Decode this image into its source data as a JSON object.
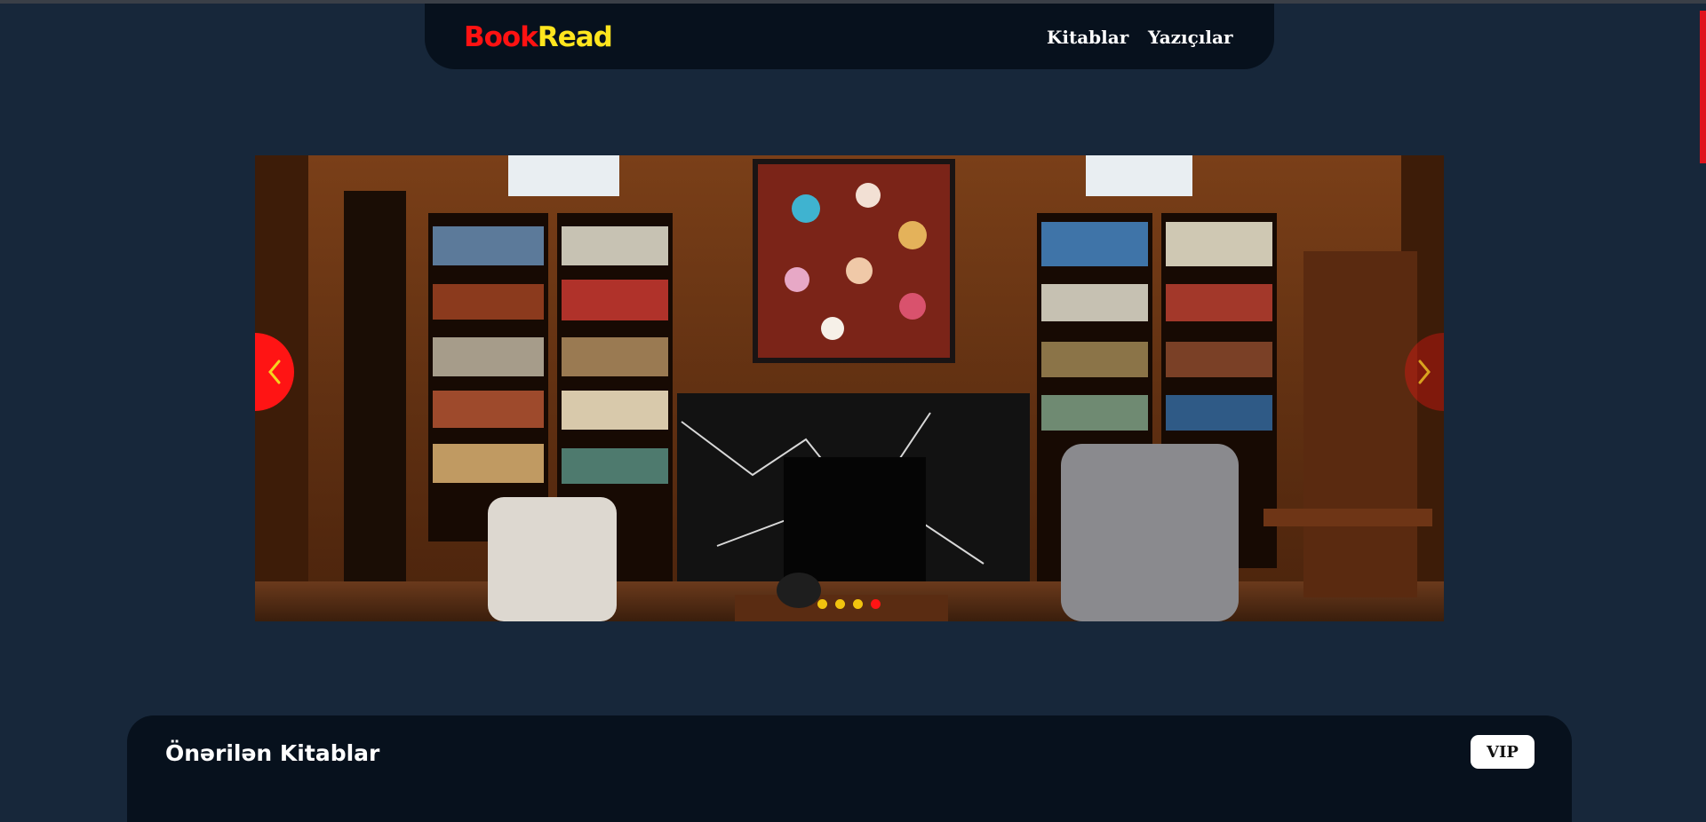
{
  "header": {
    "logo_part1": "Book",
    "logo_part2": "Read",
    "nav": [
      {
        "label": "Kitablar"
      },
      {
        "label": "Yazıçılar"
      }
    ]
  },
  "slider": {
    "image_description_icon": "library-photo",
    "slide_count": 4,
    "active_slide": 4
  },
  "recommended": {
    "title": "Önərilən Kitablar",
    "vip_label": "VIP"
  },
  "colors": {
    "background": "#17273a",
    "navbar": "#07111d",
    "logo_book": "#ff1212",
    "logo_read": "#ffe51e",
    "accent_red": "#ff1414",
    "dot_yellow": "#f1c40f"
  }
}
